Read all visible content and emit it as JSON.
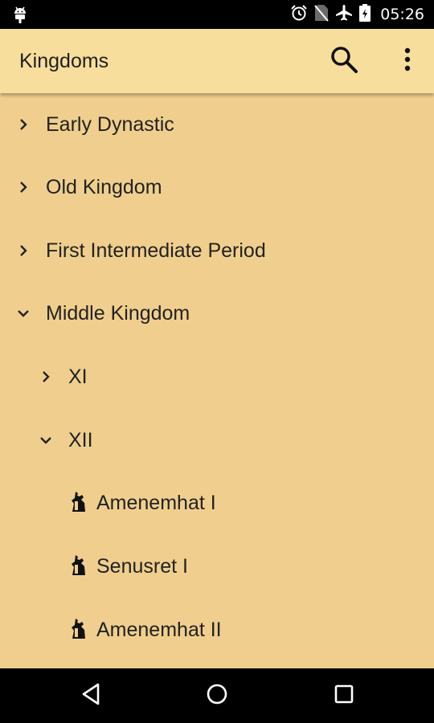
{
  "status_bar": {
    "time": "05:26",
    "icons": [
      "android-debug-icon",
      "alarm-icon",
      "no-sim-icon",
      "airplane-icon",
      "battery-icon"
    ]
  },
  "app_bar": {
    "title": "Kingdoms",
    "actions": [
      "search-icon",
      "overflow-menu-icon"
    ]
  },
  "tree": {
    "items": [
      {
        "label": "Early Dynastic",
        "expanded": false,
        "level": 0,
        "icon": "chevron-right-icon"
      },
      {
        "label": "Old Kingdom",
        "expanded": false,
        "level": 0,
        "icon": "chevron-right-icon"
      },
      {
        "label": "First Intermediate Period",
        "expanded": false,
        "level": 0,
        "icon": "chevron-right-icon"
      },
      {
        "label": "Middle Kingdom",
        "expanded": true,
        "level": 0,
        "icon": "chevron-down-icon"
      },
      {
        "label": "XI",
        "expanded": false,
        "level": 1,
        "icon": "chevron-right-icon"
      },
      {
        "label": "XII",
        "expanded": true,
        "level": 1,
        "icon": "chevron-down-icon"
      },
      {
        "label": "Amenemhat I",
        "level": 2,
        "icon": "pharaoh-icon"
      },
      {
        "label": "Senusret I",
        "level": 2,
        "icon": "pharaoh-icon"
      },
      {
        "label": "Amenemhat II",
        "level": 2,
        "icon": "pharaoh-icon"
      }
    ]
  },
  "nav_bar": {
    "buttons": [
      "back-icon",
      "home-icon",
      "recents-icon"
    ]
  },
  "colors": {
    "background": "#f0cf8e",
    "app_bar": "#f7de9c",
    "text": "#222222",
    "system_bars": "#000000"
  }
}
